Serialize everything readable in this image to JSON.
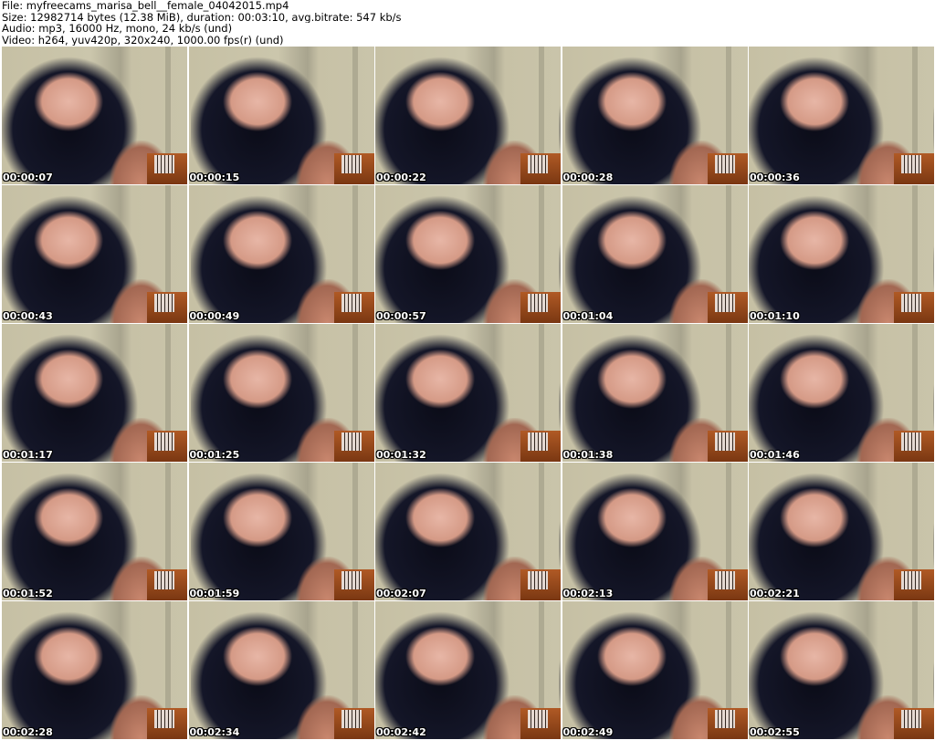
{
  "header": {
    "file": "File: myfreecams_marisa_bell__female_04042015.mp4",
    "size": "Size: 12982714 bytes (12.38 MiB), duration: 00:03:10, avg.bitrate: 547 kb/s",
    "audio": "Audio: mp3, 16000 Hz, mono, 24 kb/s (und)",
    "video": "Video: h264, yuv420p, 320x240, 1000.00 fps(r) (und)"
  },
  "thumbnails": [
    {
      "timestamp": "00:00:07"
    },
    {
      "timestamp": "00:00:15"
    },
    {
      "timestamp": "00:00:22"
    },
    {
      "timestamp": "00:00:28"
    },
    {
      "timestamp": "00:00:36"
    },
    {
      "timestamp": "00:00:43"
    },
    {
      "timestamp": "00:00:49"
    },
    {
      "timestamp": "00:00:57"
    },
    {
      "timestamp": "00:01:04"
    },
    {
      "timestamp": "00:01:10"
    },
    {
      "timestamp": "00:01:17"
    },
    {
      "timestamp": "00:01:25"
    },
    {
      "timestamp": "00:01:32"
    },
    {
      "timestamp": "00:01:38"
    },
    {
      "timestamp": "00:01:46"
    },
    {
      "timestamp": "00:01:52"
    },
    {
      "timestamp": "00:01:59"
    },
    {
      "timestamp": "00:02:07"
    },
    {
      "timestamp": "00:02:13"
    },
    {
      "timestamp": "00:02:21"
    },
    {
      "timestamp": "00:02:28"
    },
    {
      "timestamp": "00:02:34"
    },
    {
      "timestamp": "00:02:42"
    },
    {
      "timestamp": "00:02:49"
    },
    {
      "timestamp": "00:02:55"
    }
  ]
}
